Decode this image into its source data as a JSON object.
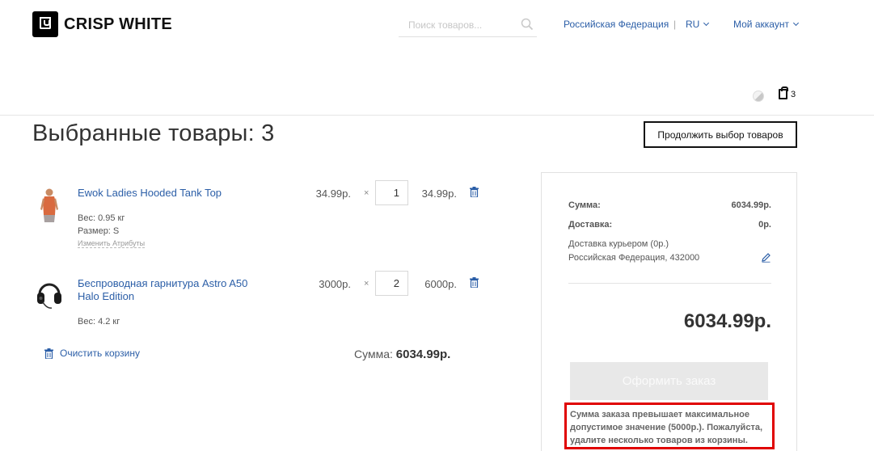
{
  "header": {
    "logo_text": "CRISP WHITE",
    "search_placeholder": "Поиск товаров...",
    "country": "Российская Федерация",
    "separator": "|",
    "language": "RU",
    "account": "Мой аккаунт",
    "cart_count": "3"
  },
  "page": {
    "title": "Выбранные товары: 3",
    "continue_label": "Продолжить выбор товаров"
  },
  "items": [
    {
      "name": "Ewok Ladies Hooded Tank Top",
      "price": "34.99р.",
      "times": "×",
      "qty": "1",
      "total": "34.99р.",
      "weight": "Вес: 0.95 кг",
      "size": "Размер: S",
      "edit_attrs": "Изменить Атрибуты",
      "thumb_icon": "tank-top-thumbnail"
    },
    {
      "name": "Беспроводная гарнитура Astro A50 Halo Edition",
      "price": "3000р.",
      "times": "×",
      "qty": "2",
      "total": "6000р.",
      "weight": "Вес: 4.2 кг",
      "thumb_icon": "headset-thumbnail"
    }
  ],
  "cart": {
    "clear_label": "Очистить корзину",
    "subtotal_label": "Сумма:",
    "subtotal_value": "6034.99р."
  },
  "summary": {
    "sum_label": "Сумма:",
    "sum_value": "6034.99р.",
    "delivery_label": "Доставка:",
    "delivery_value": "0р.",
    "delivery_method": "Доставка курьером (0р.)",
    "delivery_address": "Российская Федерация, 432000",
    "grand_total": "6034.99р.",
    "checkout_label": "Оформить заказ",
    "error_message": "Сумма заказа превышает максимальное допустимое значение (5000р.). Пожалуйста, удалите несколько товаров из корзины."
  },
  "colors": {
    "link": "#2b5ea7",
    "error_border": "#e00000",
    "disabled_button": "#e8e8e8"
  }
}
